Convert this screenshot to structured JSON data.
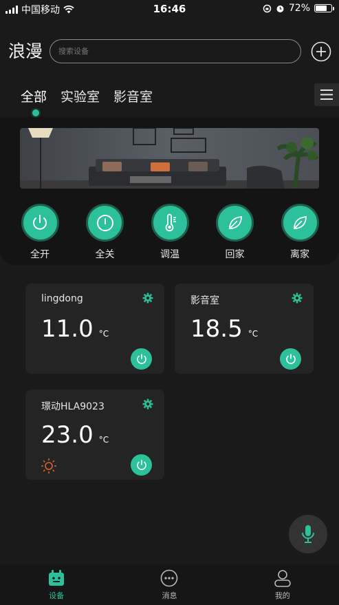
{
  "status_bar": {
    "carrier": "中国移动",
    "time": "16:46",
    "battery": "72%",
    "battery_level": 0.72
  },
  "header": {
    "brand": "浪漫",
    "search_placeholder": "搜索设备"
  },
  "tabs": [
    {
      "label": "全部",
      "active": true
    },
    {
      "label": "实验室",
      "active": false
    },
    {
      "label": "影音室",
      "active": false
    }
  ],
  "scenes": [
    {
      "label": "全开",
      "icon": "power-icon"
    },
    {
      "label": "全关",
      "icon": "power-off-icon"
    },
    {
      "label": "调温",
      "icon": "thermometer-icon"
    },
    {
      "label": "回家",
      "icon": "leaf-icon"
    },
    {
      "label": "离家",
      "icon": "leaf-icon"
    }
  ],
  "devices": [
    {
      "name": "lingdong",
      "temp": "11.0",
      "unit": "°C",
      "sun": false
    },
    {
      "name": "影音室",
      "temp": "18.5",
      "unit": "°C",
      "sun": false
    },
    {
      "name": "璟动HLA9023",
      "temp": "23.0",
      "unit": "°C",
      "sun": true
    }
  ],
  "tabbar": [
    {
      "label": "设备",
      "icon": "device-icon",
      "active": true
    },
    {
      "label": "消息",
      "icon": "message-icon",
      "active": false
    },
    {
      "label": "我的",
      "icon": "profile-icon",
      "active": false
    }
  ],
  "colors": {
    "accent": "#2cc19a",
    "background": "#1a1a1a",
    "card": "#242424",
    "sun": "#e0642a"
  }
}
